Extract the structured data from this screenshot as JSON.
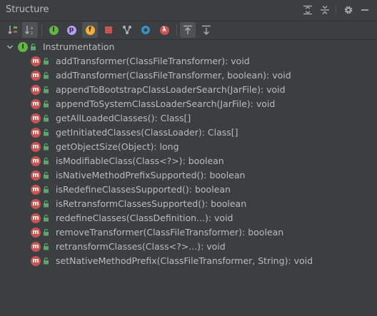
{
  "header": {
    "title": "Structure"
  },
  "toolbar": {
    "buttons": [
      {
        "icon": "sort-by-visibility-icon",
        "active": false
      },
      {
        "icon": "sort-alphabetically-icon",
        "active": true
      },
      {
        "icon": "show-inherited-icon",
        "active": false
      },
      {
        "icon": "show-properties-icon",
        "active": false
      },
      {
        "icon": "show-fields-icon",
        "active": false
      },
      {
        "icon": "show-non-public-icon",
        "active": false
      },
      {
        "icon": "show-lambdas-icon",
        "active": false
      },
      {
        "icon": "show-anonymous-icon",
        "active": false
      },
      {
        "icon": "show-lambda-icon",
        "active": false
      },
      {
        "icon": "autoscroll-to-source-icon",
        "active": true
      },
      {
        "icon": "autoscroll-from-source-icon",
        "active": false
      }
    ]
  },
  "tree": {
    "root": {
      "label": "Instrumentation",
      "badge": "I"
    },
    "items": [
      {
        "label": "addTransformer(ClassFileTransformer): void",
        "badge": "m"
      },
      {
        "label": "addTransformer(ClassFileTransformer, boolean): void",
        "badge": "m"
      },
      {
        "label": "appendToBootstrapClassLoaderSearch(JarFile): void",
        "badge": "m"
      },
      {
        "label": "appendToSystemClassLoaderSearch(JarFile): void",
        "badge": "m"
      },
      {
        "label": "getAllLoadedClasses(): Class[]",
        "badge": "m"
      },
      {
        "label": "getInitiatedClasses(ClassLoader): Class[]",
        "badge": "m"
      },
      {
        "label": "getObjectSize(Object): long",
        "badge": "m"
      },
      {
        "label": "isModifiableClass(Class<?>): boolean",
        "badge": "m"
      },
      {
        "label": "isNativeMethodPrefixSupported(): boolean",
        "badge": "m"
      },
      {
        "label": "isRedefineClassesSupported(): boolean",
        "badge": "m"
      },
      {
        "label": "isRetransformClassesSupported(): boolean",
        "badge": "m"
      },
      {
        "label": "redefineClasses(ClassDefinition...): void",
        "badge": "m"
      },
      {
        "label": "removeTransformer(ClassFileTransformer): boolean",
        "badge": "m"
      },
      {
        "label": "retransformClasses(Class<?>...): void",
        "badge": "m"
      },
      {
        "label": "setNativeMethodPrefix(ClassFileTransformer, String): void",
        "badge": "m"
      }
    ]
  },
  "colors": {
    "background": "#3c3f41",
    "text": "#bbbbbb",
    "method_badge": "#c75450",
    "interface_badge": "#62b543",
    "lock_green": "#59a869"
  }
}
